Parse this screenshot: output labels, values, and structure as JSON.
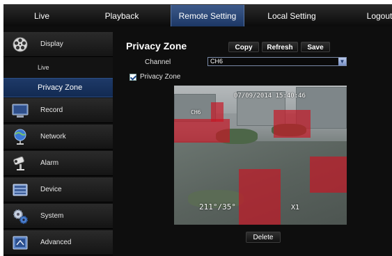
{
  "topnav": {
    "items": [
      "Live",
      "Playback",
      "Remote Setting",
      "Local Setting",
      "Logout"
    ],
    "active": "Remote Setting"
  },
  "sidebar": {
    "display": "Display",
    "sub_live": "Live",
    "sub_privacy": "Privacy Zone",
    "record": "Record",
    "network": "Network",
    "alarm": "Alarm",
    "device": "Device",
    "system": "System",
    "advanced": "Advanced"
  },
  "content": {
    "title": "Privacy Zone",
    "copy": "Copy",
    "refresh": "Refresh",
    "save": "Save",
    "channel_label": "Channel",
    "channel_value": "CH6",
    "privacy_checkbox_label": "Privacy Zone",
    "privacy_checked": true,
    "delete": "Delete"
  },
  "video": {
    "timestamp": "07/09/2014 15:40:46",
    "channel_osd": "CH6",
    "bottom_left_osd": "211°/35°",
    "zoom_osd": "X1"
  },
  "colors": {
    "accent": "#1f3b6b",
    "zone": "#c81423"
  }
}
